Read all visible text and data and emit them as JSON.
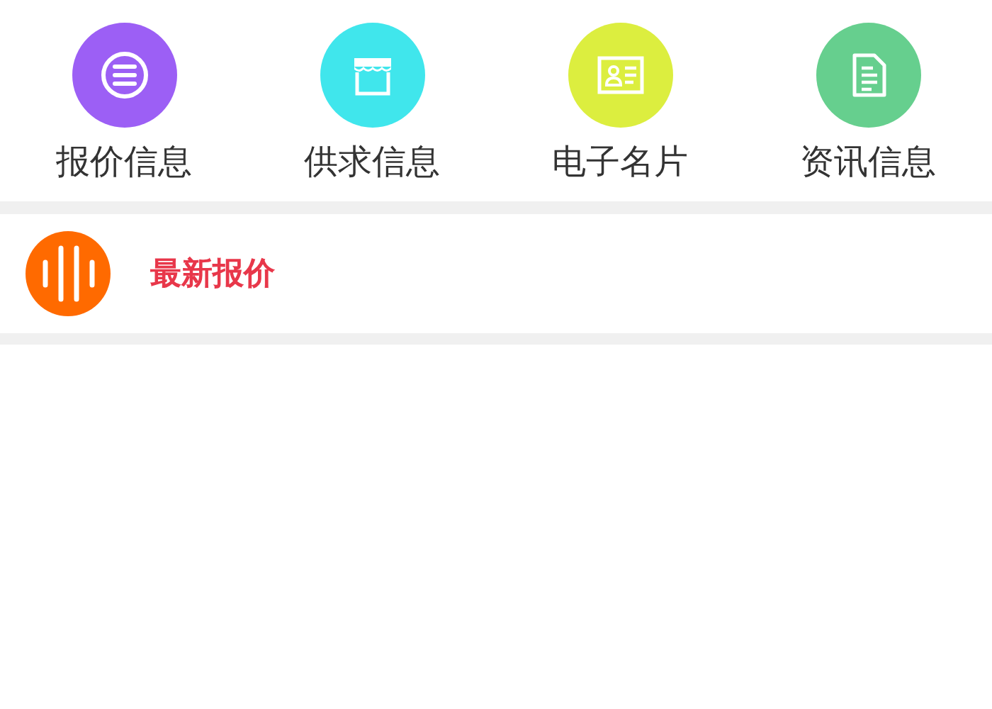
{
  "shortcuts": [
    {
      "label": "报价信息",
      "kind": "list",
      "color": "#9c5ff5"
    },
    {
      "label": "供求信息",
      "kind": "store",
      "color": "#40e6ec"
    },
    {
      "label": "电子名片",
      "kind": "card",
      "color": "#dcee3f"
    },
    {
      "label": "资讯信息",
      "kind": "document",
      "color": "#66cf8e"
    }
  ],
  "section": {
    "title": "最新报价"
  }
}
